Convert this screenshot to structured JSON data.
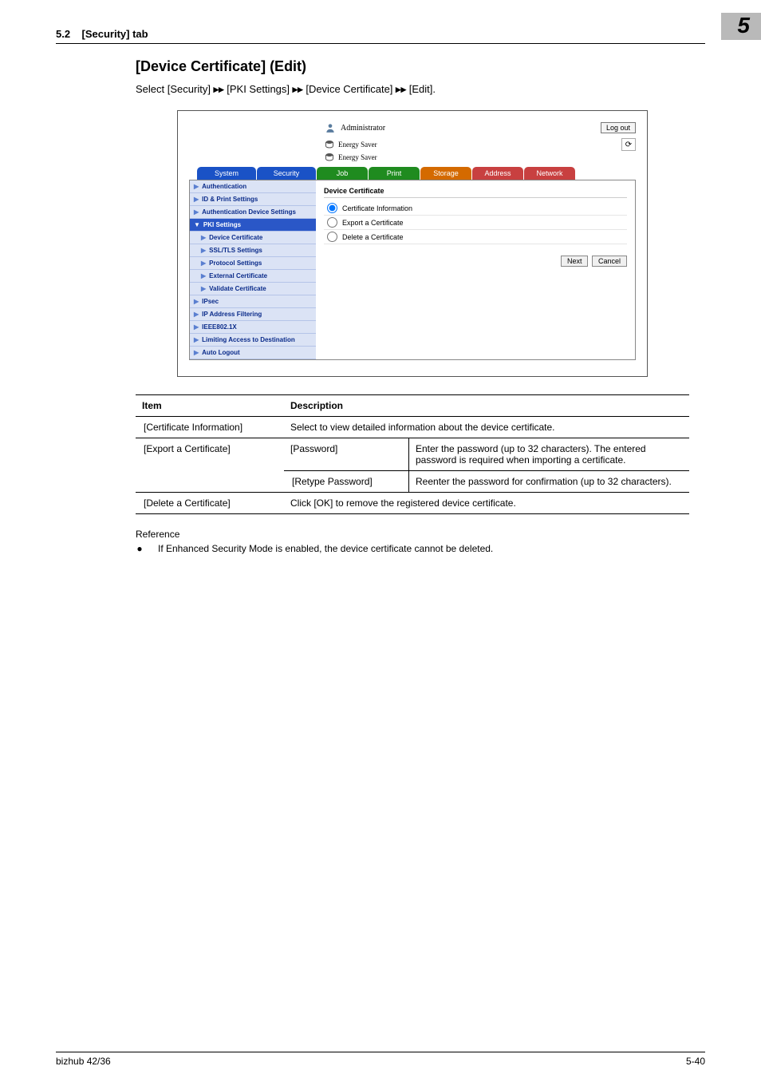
{
  "header": {
    "section_num": "5.2",
    "section_title": "[Security] tab",
    "badge": "5"
  },
  "title": "[Device Certificate] (Edit)",
  "breadcrumb": {
    "intro_prefix": "Select ",
    "parts": [
      "[Security]",
      "[PKI Settings]",
      "[Device Certificate]",
      "[Edit]"
    ]
  },
  "app": {
    "admin_label": "Administrator",
    "logout": "Log out",
    "energy1": "Energy Saver",
    "energy2": "Energy Saver",
    "tabs": {
      "system": "System",
      "security": "Security",
      "job": "Job",
      "print": "Print",
      "storage": "Storage",
      "address": "Address",
      "network": "Network"
    },
    "sidebar": {
      "items": [
        {
          "label": "Authentication"
        },
        {
          "label": "ID & Print Settings"
        },
        {
          "label": "Authentication Device Settings"
        },
        {
          "label": "PKI Settings",
          "selected": true,
          "marker": "▼"
        },
        {
          "label": "Device Certificate",
          "sub": true
        },
        {
          "label": "SSL/TLS Settings",
          "sub": true
        },
        {
          "label": "Protocol Settings",
          "sub": true
        },
        {
          "label": "External Certificate",
          "sub": true
        },
        {
          "label": "Validate Certificate",
          "sub": true
        },
        {
          "label": "IPsec"
        },
        {
          "label": "IP Address Filtering"
        },
        {
          "label": "IEEE802.1X"
        },
        {
          "label": "Limiting Access to Destination"
        },
        {
          "label": "Auto Logout"
        }
      ]
    },
    "panel": {
      "title": "Device Certificate",
      "options": [
        {
          "label": "Certificate Information",
          "checked": true
        },
        {
          "label": "Export a Certificate"
        },
        {
          "label": "Delete a Certificate"
        }
      ],
      "next_btn": "Next",
      "cancel_btn": "Cancel"
    }
  },
  "table": {
    "head": {
      "item": "Item",
      "desc": "Description"
    },
    "rows": {
      "r1": {
        "item": "[Certificate Information]",
        "desc": "Select to view detailed information about the device certificate."
      },
      "r2": {
        "item": "[Export a Certificate]",
        "sub1": {
          "k": "[Password]",
          "v": "Enter the password (up to 32 characters). The entered password is required when importing a certificate."
        },
        "sub2": {
          "k": "[Retype Password]",
          "v": "Reenter the password for confirmation (up to 32 characters)."
        }
      },
      "r3": {
        "item": "[Delete a Certificate]",
        "desc": "Click [OK] to remove the registered device certificate."
      }
    }
  },
  "reference": {
    "label": "Reference",
    "bullet": "If Enhanced Security Mode is enabled, the device certificate cannot be deleted."
  },
  "footer": {
    "left": "bizhub 42/36",
    "right": "5-40"
  }
}
